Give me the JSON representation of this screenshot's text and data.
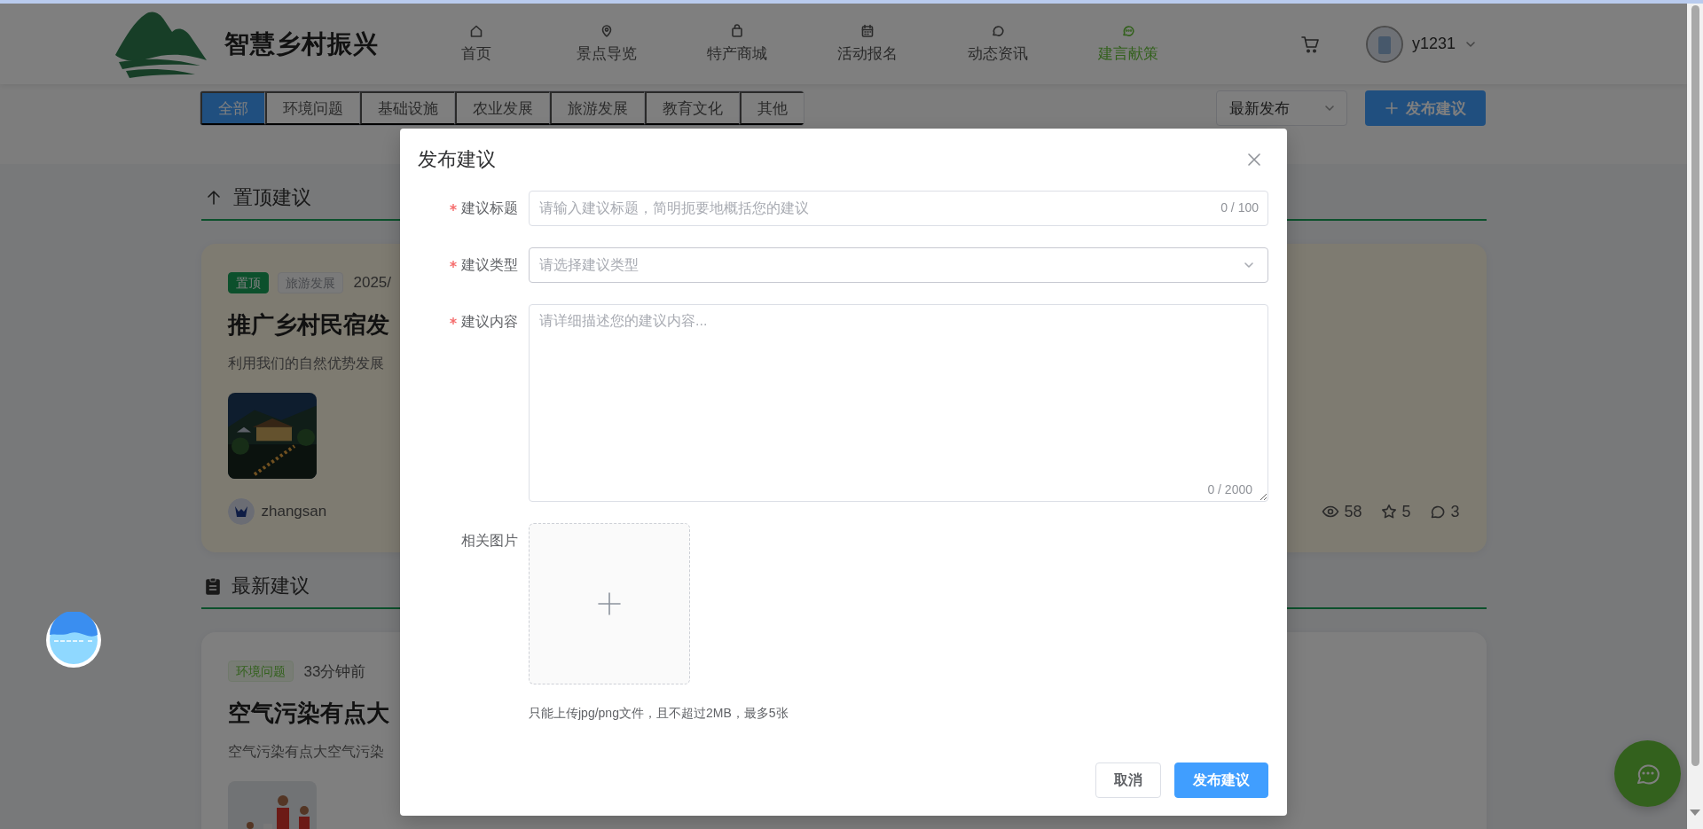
{
  "header": {
    "site_title": "智慧乡村振兴",
    "nav": [
      {
        "label": "首页",
        "selected": false
      },
      {
        "label": "景点导览",
        "selected": false
      },
      {
        "label": "特产商城",
        "selected": false
      },
      {
        "label": "活动报名",
        "selected": false
      },
      {
        "label": "动态资讯",
        "selected": false
      },
      {
        "label": "建言献策",
        "selected": true
      }
    ],
    "user": {
      "name": "y1231"
    }
  },
  "filter": {
    "categories": [
      {
        "label": "全部",
        "selected": true
      },
      {
        "label": "环境问题",
        "selected": false
      },
      {
        "label": "基础设施",
        "selected": false
      },
      {
        "label": "农业发展",
        "selected": false
      },
      {
        "label": "旅游发展",
        "selected": false
      },
      {
        "label": "教育文化",
        "selected": false
      },
      {
        "label": "其他",
        "selected": false
      }
    ],
    "sort": {
      "value": "最新发布"
    },
    "publish_button": {
      "label": "发布建议"
    }
  },
  "sections": [
    {
      "title": "置顶建议",
      "posts": [
        {
          "pinned": true,
          "tags": [
            {
              "label": "置顶",
              "kind": "solid"
            },
            {
              "label": "旅游发展",
              "kind": "neutral"
            }
          ],
          "time": "2025/",
          "title": "推广乡村民宿发",
          "summary": "利用我们的自然优势发展",
          "picture": {
            "kind": "picture"
          },
          "author": {
            "name": "zhangsan"
          },
          "stats": {
            "views": "58",
            "favorites": "5",
            "comments": "3"
          }
        }
      ]
    },
    {
      "title": "最新建议",
      "posts": [
        {
          "pinned": false,
          "tags": [
            {
              "label": "环境问题",
              "kind": "success"
            }
          ],
          "time": "33分钟前",
          "title": "空气污染有点大",
          "summary": "空气污染有点大空气污染",
          "picture": {
            "kind": "picture"
          }
        }
      ]
    }
  ],
  "dialog": {
    "title": "发布建议",
    "fields": [
      {
        "kind": "text",
        "label": "建议标题",
        "required": true,
        "placeholder": "请输入建议标题，简明扼要地概括您的建议",
        "counter": "0 / 100"
      },
      {
        "kind": "select",
        "label": "建议类型",
        "required": true,
        "placeholder": "请选择建议类型"
      },
      {
        "kind": "textarea",
        "label": "建议内容",
        "required": true,
        "placeholder": "请详细描述您的建议内容...",
        "counter": "0 / 2000"
      },
      {
        "kind": "upload",
        "label": "相关图片",
        "required": false,
        "hint": "只能上传jpg/png文件，且不超过2MB，最多5张"
      }
    ],
    "buttons": [
      {
        "label": "取消",
        "kind": "default"
      },
      {
        "label": "发布建议",
        "kind": "primary"
      }
    ]
  }
}
